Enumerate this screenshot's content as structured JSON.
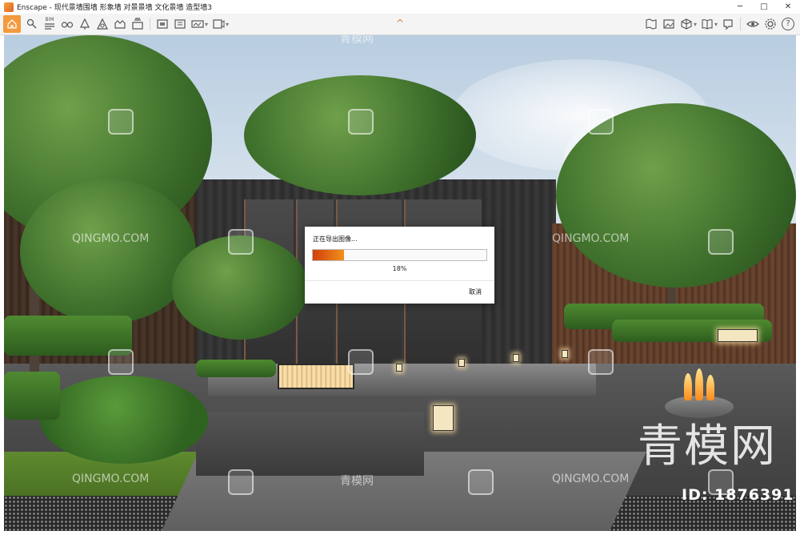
{
  "window": {
    "title": "Enscape - 现代景墙围墙 形象墙 对景景墙 文化景墙 造型墙3",
    "minimize_glyph": "─",
    "maximize_glyph": "□",
    "close_glyph": "✕"
  },
  "toolbar": {
    "left_icons": [
      "home-icon",
      "location-pin-icon",
      "bim-icon",
      "binoculars-icon",
      "tree-icon",
      "asset-library-icon",
      "atmosphere-icon",
      "export-icon",
      "screenshot-icon",
      "batch-render-icon",
      "panorama-icon",
      "video-export-icon"
    ],
    "bim_label": "BIM",
    "collapse_glyph": "^",
    "right_icons": [
      "map-icon",
      "image-icon",
      "cube-icon",
      "book-icon",
      "capture-icon",
      "eye-icon",
      "gear-icon",
      "help-icon"
    ],
    "help_glyph": "?"
  },
  "dialog": {
    "title": "正在导出图像...",
    "progress_percent": 18,
    "progress_label": "18%",
    "cancel_label": "取消"
  },
  "watermarks": {
    "site_text": "QINGMO.COM",
    "brand_text": "青模网",
    "brand_large": "青模网",
    "id_text": "ID: 1876391"
  },
  "colors": {
    "accent": "#F29A3C",
    "progress_start": "#D23F0C",
    "progress_end": "#F0901B"
  }
}
